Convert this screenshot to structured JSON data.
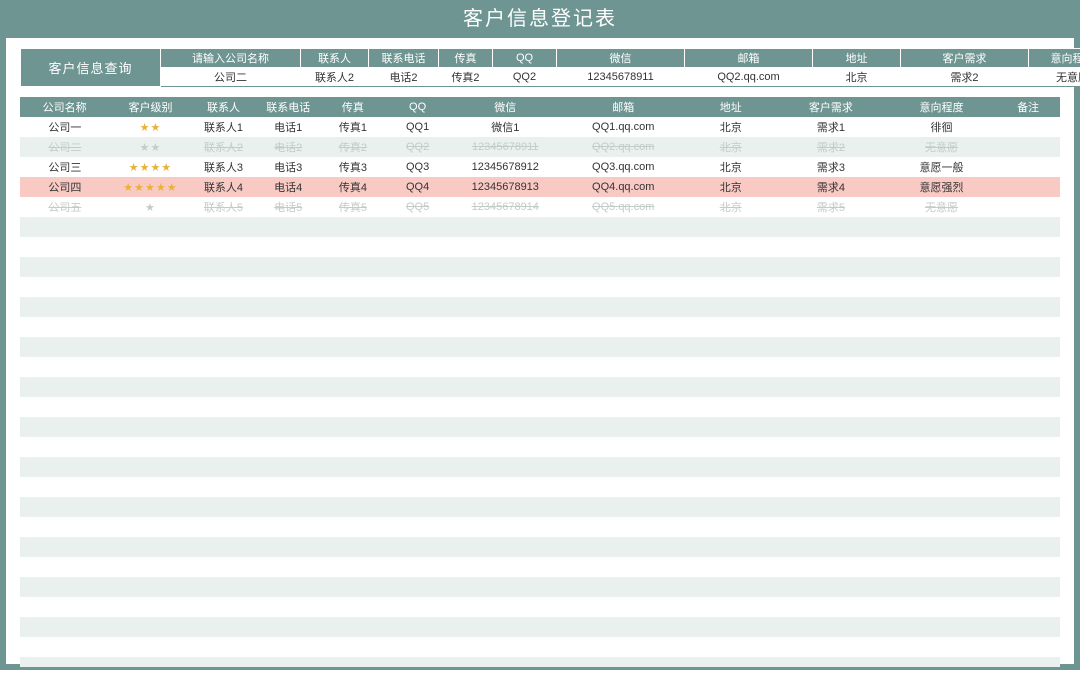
{
  "title": "客户信息登记表",
  "query": {
    "left_label": "客户信息查询",
    "headers": [
      "请输入公司名称",
      "联系人",
      "联系电话",
      "传真",
      "QQ",
      "微信",
      "邮箱",
      "地址",
      "客户需求",
      "意向程度"
    ],
    "values": [
      "公司二",
      "联系人2",
      "电话2",
      "传真2",
      "QQ2",
      "12345678911",
      "QQ2.qq.com",
      "北京",
      "需求2",
      "无意愿"
    ]
  },
  "table": {
    "headers": [
      "公司名称",
      "客户级别",
      "联系人",
      "联系电话",
      "传真",
      "QQ",
      "微信",
      "邮箱",
      "地址",
      "客户需求",
      "意向程度",
      "备注"
    ],
    "rows": [
      {
        "state": "normal",
        "company": "公司一",
        "stars": "★★",
        "star_style": "gold",
        "contact": "联系人1",
        "phone": "电话1",
        "fax": "传真1",
        "qq": "QQ1",
        "wechat": "微信1",
        "email": "QQ1.qq.com",
        "addr": "北京",
        "need": "需求1",
        "intent": "徘徊",
        "note": ""
      },
      {
        "state": "dim",
        "company": "公司二",
        "stars": "★★",
        "star_style": "grey",
        "contact": "联系人2",
        "phone": "电话2",
        "fax": "传真2",
        "qq": "QQ2",
        "wechat": "12345678911",
        "email": "QQ2.qq.com",
        "addr": "北京",
        "need": "需求2",
        "intent": "无意愿",
        "note": ""
      },
      {
        "state": "normal",
        "company": "公司三",
        "stars": "★★★★",
        "star_style": "gold",
        "contact": "联系人3",
        "phone": "电话3",
        "fax": "传真3",
        "qq": "QQ3",
        "wechat": "12345678912",
        "email": "QQ3.qq.com",
        "addr": "北京",
        "need": "需求3",
        "intent": "意愿一般",
        "note": ""
      },
      {
        "state": "hl",
        "company": "公司四",
        "stars": "★★★★★",
        "star_style": "gold",
        "contact": "联系人4",
        "phone": "电话4",
        "fax": "传真4",
        "qq": "QQ4",
        "wechat": "12345678913",
        "email": "QQ4.qq.com",
        "addr": "北京",
        "need": "需求4",
        "intent": "意愿强烈",
        "note": ""
      },
      {
        "state": "dim",
        "company": "公司五",
        "stars": "★",
        "star_style": "grey",
        "contact": "联系人5",
        "phone": "电话5",
        "fax": "传真5",
        "qq": "QQ5",
        "wechat": "12345678914",
        "email": "QQ5.qq.com",
        "addr": "北京",
        "need": "需求5",
        "intent": "无意愿",
        "note": ""
      }
    ],
    "blank_rows": 23
  },
  "col_widths_data": [
    86,
    78,
    62,
    62,
    62,
    62,
    106,
    120,
    86,
    106,
    106,
    60
  ],
  "col_widths_query": [
    140,
    140,
    68,
    70,
    54,
    64,
    128,
    128,
    88,
    128,
    88
  ]
}
